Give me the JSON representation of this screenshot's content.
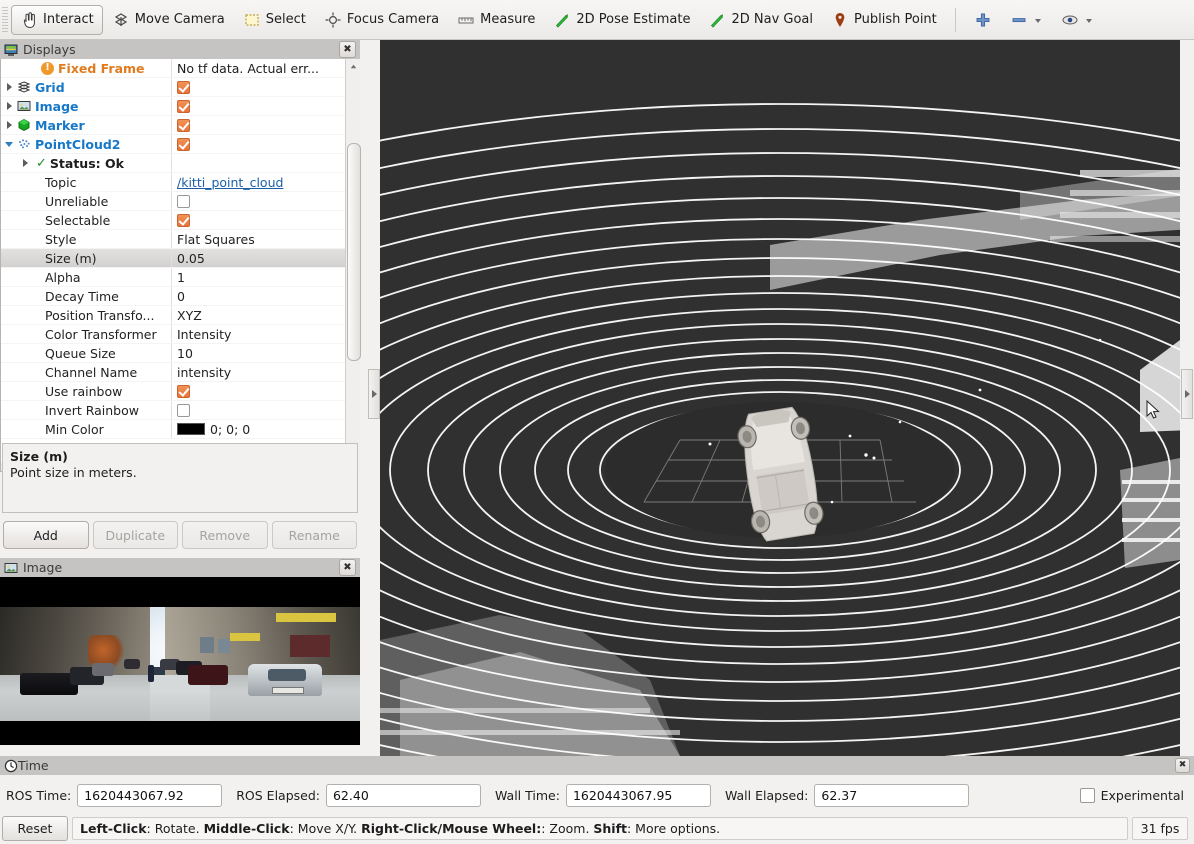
{
  "toolbar": {
    "items": [
      {
        "label": "Interact",
        "icon": "hand-cursor-icon",
        "active": true
      },
      {
        "label": "Move Camera",
        "icon": "move-camera-icon",
        "active": false
      },
      {
        "label": "Select",
        "icon": "select-rectangle-icon",
        "active": false
      },
      {
        "label": "Focus Camera",
        "icon": "focus-camera-icon",
        "active": false
      },
      {
        "label": "Measure",
        "icon": "ruler-icon",
        "active": false
      },
      {
        "label": "2D Pose Estimate",
        "icon": "pose-arrow-icon",
        "active": false
      },
      {
        "label": "2D Nav Goal",
        "icon": "nav-goal-arrow-icon",
        "active": false
      },
      {
        "label": "Publish Point",
        "icon": "map-pin-icon",
        "active": false
      }
    ],
    "add_icon": "plus-icon",
    "remove_icon": "minus-icon",
    "views_icon": "eye-icon"
  },
  "displays": {
    "title": "Displays",
    "close_icon": "close-icon",
    "rows": [
      {
        "name": "Fixed Frame",
        "value": "No tf data.  Actual err...",
        "kind": "warning",
        "indent": 2
      },
      {
        "name": "Grid",
        "value": "",
        "kind": "display",
        "icon": "grid-icon",
        "indent": 0,
        "expander": "right",
        "checked": true
      },
      {
        "name": "Image",
        "value": "",
        "kind": "display",
        "icon": "image-icon",
        "indent": 0,
        "expander": "right",
        "checked": true
      },
      {
        "name": "Marker",
        "value": "",
        "kind": "display",
        "icon": "marker-cube-icon",
        "indent": 0,
        "expander": "right",
        "checked": true
      },
      {
        "name": "PointCloud2",
        "value": "",
        "kind": "display",
        "icon": "pointcloud-icon",
        "indent": 0,
        "expander": "down",
        "checked": true
      },
      {
        "name": "Status: Ok",
        "value": "",
        "kind": "status",
        "indent": 1,
        "expander": "right"
      },
      {
        "name": "Topic",
        "value": "/kitti_point_cloud",
        "kind": "link",
        "indent": 2
      },
      {
        "name": "Unreliable",
        "value": "",
        "kind": "checkbox",
        "indent": 2,
        "checked": false
      },
      {
        "name": "Selectable",
        "value": "",
        "kind": "checkbox",
        "indent": 2,
        "checked": true
      },
      {
        "name": "Style",
        "value": "Flat Squares",
        "kind": "text",
        "indent": 2
      },
      {
        "name": "Size (m)",
        "value": "0.05",
        "kind": "text",
        "indent": 2,
        "selected": true
      },
      {
        "name": "Alpha",
        "value": "1",
        "kind": "text",
        "indent": 2
      },
      {
        "name": "Decay Time",
        "value": "0",
        "kind": "text",
        "indent": 2
      },
      {
        "name": "Position Transfo...",
        "value": "XYZ",
        "kind": "text",
        "indent": 2
      },
      {
        "name": "Color Transformer",
        "value": "Intensity",
        "kind": "text",
        "indent": 2
      },
      {
        "name": "Queue Size",
        "value": "10",
        "kind": "text",
        "indent": 2
      },
      {
        "name": "Channel Name",
        "value": "intensity",
        "kind": "text",
        "indent": 2
      },
      {
        "name": "Use rainbow",
        "value": "",
        "kind": "checkbox",
        "indent": 2,
        "checked": true
      },
      {
        "name": "Invert Rainbow",
        "value": "",
        "kind": "checkbox",
        "indent": 2,
        "checked": false
      },
      {
        "name": "Min Color",
        "value": "0; 0; 0",
        "kind": "color",
        "indent": 2,
        "swatch": "#000000"
      }
    ],
    "help": {
      "title": "Size (m)",
      "text": "Point size in meters."
    },
    "buttons": [
      {
        "label": "Add",
        "enabled": true
      },
      {
        "label": "Duplicate",
        "enabled": false
      },
      {
        "label": "Remove",
        "enabled": false
      },
      {
        "label": "Rename",
        "enabled": false
      }
    ]
  },
  "image_panel": {
    "title": "Image",
    "icon": "image-icon",
    "close_icon": "close-icon"
  },
  "view3d": {
    "background_color": "#303030",
    "collapse_left_icon": "collapse-left-icon",
    "collapse_right_icon": "collapse-right-icon"
  },
  "time_panel": {
    "title": "Time",
    "icon": "clock-icon",
    "close_icon": "close-icon",
    "ros_time_label": "ROS Time:",
    "ros_time_value": "1620443067.92",
    "ros_elapsed_label": "ROS Elapsed:",
    "ros_elapsed_value": "62.40",
    "wall_time_label": "Wall Time:",
    "wall_time_value": "1620443067.95",
    "wall_elapsed_label": "Wall Elapsed:",
    "wall_elapsed_value": "62.37",
    "experimental_label": "Experimental",
    "experimental_checked": false
  },
  "statusbar": {
    "reset_label": "Reset",
    "hint_parts": [
      {
        "text": "Left-Click",
        "bold": true
      },
      {
        "text": ": Rotate.  ",
        "bold": false
      },
      {
        "text": "Middle-Click",
        "bold": true
      },
      {
        "text": ": Move X/Y.  ",
        "bold": false
      },
      {
        "text": "Right-Click/Mouse Wheel:",
        "bold": true
      },
      {
        "text": ": Zoom.  ",
        "bold": false
      },
      {
        "text": "Shift",
        "bold": true
      },
      {
        "text": ": More options.",
        "bold": false
      }
    ],
    "fps": "31 fps"
  },
  "colors": {
    "accent_blue": "#1878c8",
    "check_orange": "#e9733a",
    "warn_orange": "#e07b1e",
    "viewport_bg": "#303030"
  }
}
